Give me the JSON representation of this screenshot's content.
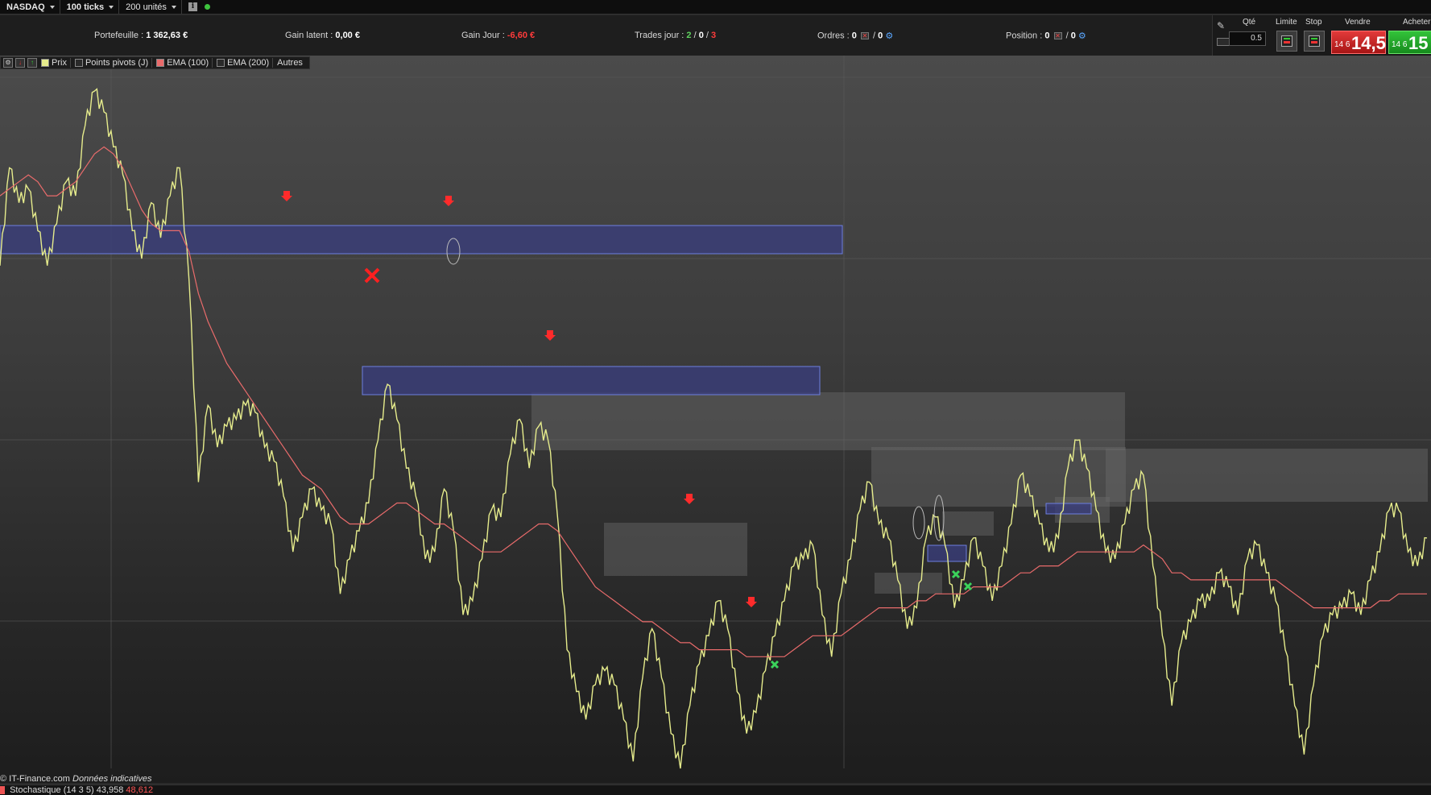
{
  "toolbar": {
    "market": "NASDAQ",
    "interval": "100 ticks",
    "units": "200 unités",
    "info_icon": "i"
  },
  "stats": {
    "portfolio_label": "Portefeuille :",
    "portfolio_value": "1 362,63 €",
    "unrealized_label": "Gain latent :",
    "unrealized_value": "0,00 €",
    "daily_label": "Gain Jour :",
    "daily_value": "-6,60 €",
    "trades_label": "Trades jour :",
    "trades_won": "2",
    "trades_sep1": "/",
    "trades_neutral": "0",
    "trades_sep2": "/",
    "trades_lost": "3",
    "orders_label": "Ordres :",
    "orders_count_a": "0",
    "orders_count_b": "0",
    "orders_sep": "/",
    "position_label": "Position :",
    "position_count_a": "0",
    "position_count_b": "0",
    "position_sep": "/"
  },
  "order_panel": {
    "qty_label": "Qté",
    "qty_value": "0.5",
    "limit_label": "Limite",
    "stop_label": "Stop",
    "sell_label": "Vendre",
    "buy_label": "Acheter",
    "sell_price_small": "14 6",
    "sell_price_big": "14,5",
    "buy_price_small": "14 6",
    "buy_price_big": "15"
  },
  "legend": {
    "price": "Prix",
    "pivots": "Points pivots (J)",
    "ema100": "EMA (100)",
    "ema200": "EMA (200)",
    "others": "Autres"
  },
  "colors": {
    "price_line": "#e6ec8c",
    "ema_line": "#e96b6b",
    "zone_blue": "#3a3d7a",
    "zone_blue_border": "#6d7fe0",
    "zone_grey": "#6a6a6a",
    "sell_arrow": "#ff2b2b",
    "buy_marker": "#3bd35b",
    "loss_marker": "#ff2020"
  },
  "footer": {
    "credit": "© IT-Finance.com",
    "note": "Données indicatives"
  },
  "stochastic": {
    "label": "Stochastique (14 3 5)",
    "value_k": "43,958",
    "value_d": "48,612"
  },
  "chart_data": {
    "type": "line",
    "series": [
      {
        "name": "Prix",
        "values": [
          0.72,
          0.86,
          0.81,
          0.83,
          0.77,
          0.72,
          0.78,
          0.84,
          0.82,
          0.92,
          0.97,
          0.94,
          0.89,
          0.85,
          0.77,
          0.73,
          0.81,
          0.76,
          0.82,
          0.86,
          0.7,
          0.41,
          0.52,
          0.46,
          0.49,
          0.5,
          0.52,
          0.51,
          0.46,
          0.44,
          0.39,
          0.31,
          0.36,
          0.4,
          0.37,
          0.35,
          0.25,
          0.3,
          0.34,
          0.38,
          0.47,
          0.55,
          0.5,
          0.43,
          0.39,
          0.3,
          0.31,
          0.4,
          0.34,
          0.22,
          0.24,
          0.3,
          0.37,
          0.36,
          0.45,
          0.5,
          0.43,
          0.49,
          0.47,
          0.36,
          0.17,
          0.11,
          0.07,
          0.12,
          0.14,
          0.12,
          0.07,
          0.01,
          0.13,
          0.2,
          0.13,
          0.05,
          0.0,
          0.09,
          0.15,
          0.19,
          0.24,
          0.2,
          0.11,
          0.05,
          0.08,
          0.14,
          0.19,
          0.24,
          0.29,
          0.3,
          0.32,
          0.22,
          0.16,
          0.25,
          0.3,
          0.37,
          0.41,
          0.35,
          0.33,
          0.27,
          0.2,
          0.23,
          0.33,
          0.36,
          0.32,
          0.23,
          0.27,
          0.33,
          0.29,
          0.24,
          0.29,
          0.35,
          0.42,
          0.39,
          0.35,
          0.31,
          0.33,
          0.43,
          0.47,
          0.43,
          0.37,
          0.31,
          0.3,
          0.35,
          0.4,
          0.42,
          0.29,
          0.19,
          0.09,
          0.18,
          0.21,
          0.24,
          0.24,
          0.28,
          0.26,
          0.22,
          0.3,
          0.32,
          0.28,
          0.24,
          0.17,
          0.09,
          0.02,
          0.12,
          0.19,
          0.22,
          0.23,
          0.25,
          0.22,
          0.27,
          0.31,
          0.37,
          0.37,
          0.31,
          0.29,
          0.33
        ]
      },
      {
        "name": "EMA (100)",
        "values": [
          0.82,
          0.83,
          0.84,
          0.85,
          0.84,
          0.82,
          0.82,
          0.83,
          0.84,
          0.86,
          0.88,
          0.89,
          0.88,
          0.86,
          0.83,
          0.8,
          0.78,
          0.77,
          0.77,
          0.77,
          0.74,
          0.68,
          0.64,
          0.61,
          0.58,
          0.56,
          0.54,
          0.52,
          0.5,
          0.48,
          0.46,
          0.44,
          0.42,
          0.41,
          0.4,
          0.38,
          0.36,
          0.35,
          0.35,
          0.35,
          0.36,
          0.37,
          0.38,
          0.38,
          0.37,
          0.36,
          0.35,
          0.35,
          0.34,
          0.33,
          0.32,
          0.31,
          0.31,
          0.31,
          0.32,
          0.33,
          0.34,
          0.35,
          0.35,
          0.34,
          0.32,
          0.3,
          0.28,
          0.26,
          0.25,
          0.24,
          0.23,
          0.22,
          0.21,
          0.21,
          0.2,
          0.19,
          0.18,
          0.18,
          0.17,
          0.17,
          0.17,
          0.17,
          0.17,
          0.16,
          0.16,
          0.16,
          0.16,
          0.16,
          0.17,
          0.18,
          0.19,
          0.19,
          0.19,
          0.19,
          0.2,
          0.21,
          0.22,
          0.23,
          0.23,
          0.23,
          0.23,
          0.24,
          0.24,
          0.25,
          0.25,
          0.25,
          0.25,
          0.26,
          0.26,
          0.26,
          0.26,
          0.27,
          0.28,
          0.28,
          0.29,
          0.29,
          0.29,
          0.3,
          0.31,
          0.31,
          0.31,
          0.31,
          0.31,
          0.31,
          0.31,
          0.32,
          0.31,
          0.3,
          0.28,
          0.28,
          0.27,
          0.27,
          0.27,
          0.27,
          0.27,
          0.27,
          0.27,
          0.27,
          0.27,
          0.27,
          0.26,
          0.25,
          0.24,
          0.23,
          0.23,
          0.23,
          0.23,
          0.23,
          0.23,
          0.23,
          0.24,
          0.24,
          0.25,
          0.25,
          0.25,
          0.25
        ]
      }
    ],
    "ylim": [
      0,
      1
    ]
  }
}
